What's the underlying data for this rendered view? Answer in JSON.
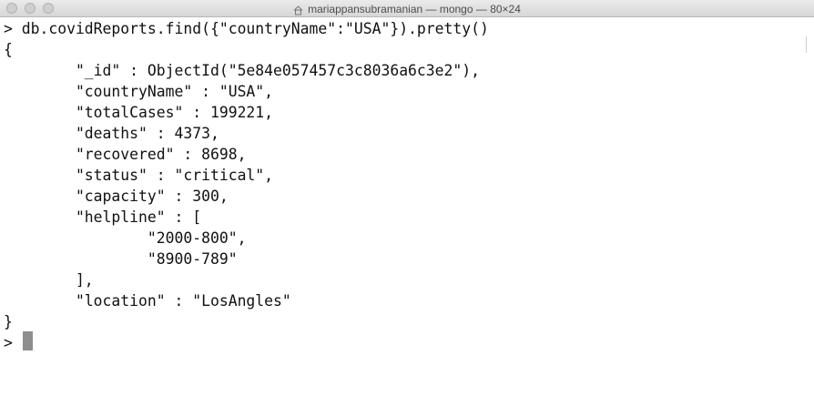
{
  "window": {
    "title": "mariappansubramanian — mongo — 80×24",
    "icon": "house-icon",
    "controls": [
      "close",
      "minimize",
      "zoom"
    ]
  },
  "terminal": {
    "lines": [
      "> db.covidReports.find({\"countryName\":\"USA\"}).pretty()",
      "{",
      "        \"_id\" : ObjectId(\"5e84e057457c3c8036a6c3e2\"),",
      "        \"countryName\" : \"USA\",",
      "        \"totalCases\" : 199221,",
      "        \"deaths\" : 4373,",
      "        \"recovered\" : 8698,",
      "        \"status\" : \"critical\",",
      "        \"capacity\" : 300,",
      "        \"helpline\" : [",
      "                \"2000-800\",",
      "                \"8900-789\"",
      "        ],",
      "        \"location\" : \"LosAngles\"",
      "}",
      "> "
    ]
  }
}
